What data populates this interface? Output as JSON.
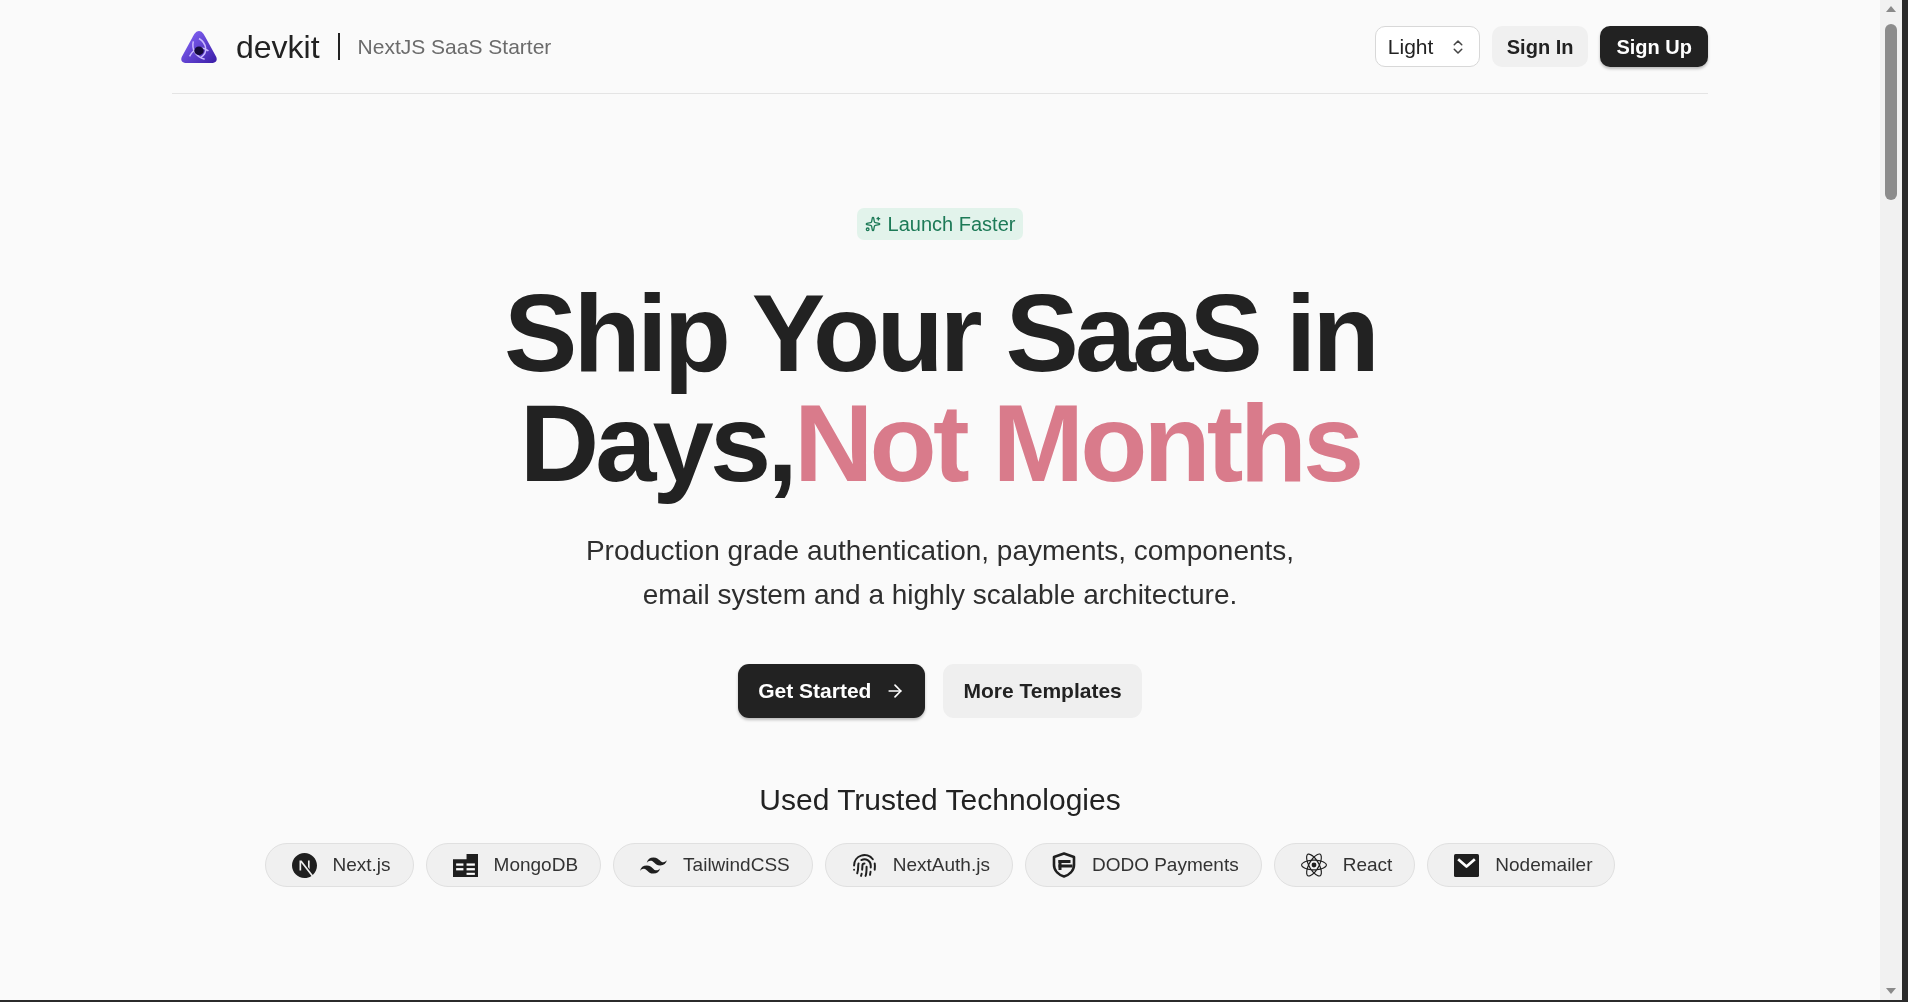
{
  "header": {
    "brand": "devkit",
    "tagline": "NextJS SaaS Starter",
    "theme_select": {
      "value": "Light"
    },
    "sign_in": "Sign In",
    "sign_up": "Sign Up"
  },
  "hero": {
    "badge": "Launch Faster",
    "title": "Ship Your SaaS in Days,",
    "title_highlight": "Not Months",
    "description": "Production grade authentication, payments, components, email system and a highly scalable architecture.",
    "buttons": [
      {
        "label": "Get Started",
        "kind": "primary"
      },
      {
        "label": "More Templates",
        "kind": "secondary"
      }
    ]
  },
  "technologies": {
    "heading": "Used Trusted Technologies",
    "items": [
      {
        "name": "Next.js",
        "kind": "n-logo"
      },
      {
        "name": "MongoDB",
        "kind": "tiles"
      },
      {
        "name": "TailwindCSS",
        "kind": "wave"
      },
      {
        "name": "NextAuth.js",
        "kind": "fingerprint"
      },
      {
        "name": "DODO Payments",
        "kind": "shield"
      },
      {
        "name": "React",
        "kind": "atom"
      },
      {
        "name": "Nodemailer",
        "kind": "envelope"
      }
    ]
  }
}
